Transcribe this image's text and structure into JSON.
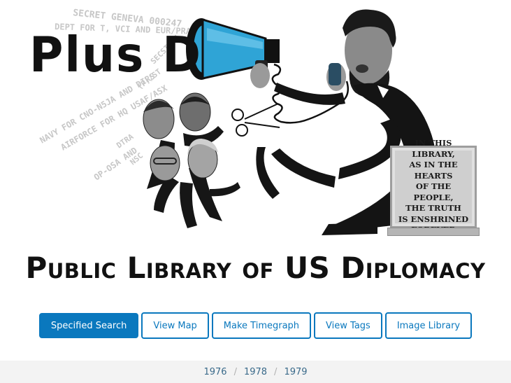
{
  "logo": {
    "text": "Plus D"
  },
  "hero": {
    "cable_text": [
      "SECRET GENEVA 000247",
      "DEPT FOR T, VCI AND EUR/PRA",
      "SECSTATE",
      "(P)/ST",
      "NAVY FOR CNO-N5JA AND DIRS",
      "AIRFORCE FOR HQ USAF/ASX",
      "DTRA",
      "OP-OSA AND",
      "NSC"
    ],
    "plaque_text": "In this library,\nas in the hearts\nof the people,\nthe truth\nis enshrined\nforever"
  },
  "headline": "Public Library of US Diplomacy",
  "nav": {
    "buttons": [
      {
        "label": "Specified Search",
        "primary": true
      },
      {
        "label": "View Map",
        "primary": false
      },
      {
        "label": "Make Timegraph",
        "primary": false
      },
      {
        "label": "View Tags",
        "primary": false
      },
      {
        "label": "Image Library",
        "primary": false
      }
    ]
  },
  "years": [
    "1976",
    "1978",
    "1979"
  ],
  "colors": {
    "accent": "#0a78be",
    "megaphone": "#2fa4d6",
    "yearbar_bg": "#f3f3f3"
  }
}
